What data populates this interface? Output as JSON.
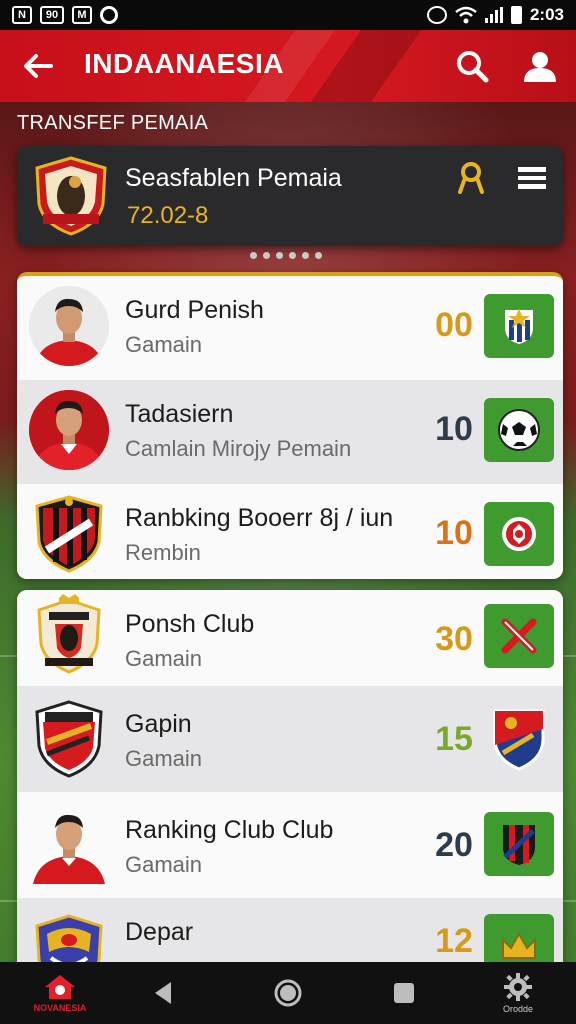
{
  "status_bar": {
    "left_icons": [
      "sim-icon",
      "nfc-icon",
      "calendar-icon",
      "sync-icon"
    ],
    "right_icons": [
      "vibrate-icon",
      "wifi-icon",
      "signal-icon",
      "battery-icon"
    ],
    "time": "2:03",
    "left_glyphs": [
      "N",
      "90",
      "M"
    ]
  },
  "app_bar": {
    "title": "INDAANAESIA",
    "accent": "#d0141c"
  },
  "section": {
    "label": "TRANSFEF PEMAIA"
  },
  "featured": {
    "title": "Seasfablen Pemaia",
    "date": "72.02-8",
    "carousel_pages": 6
  },
  "list_a": [
    {
      "name": "Gurd Penish",
      "subtitle": "Gamain",
      "score": "00",
      "score_color": "#d69a1a",
      "badge": "shield-star-icon",
      "avatar": "player-photo"
    },
    {
      "name": "Tadasiern",
      "subtitle": "Camlain Mirojy Pemain",
      "score": "10",
      "score_color": "#2d3b4a",
      "badge": "soccer-ball-icon",
      "avatar": "player-photo"
    },
    {
      "name": "Ranbking Booerr 8j / iun",
      "subtitle": "Rembin",
      "score": "10",
      "score_color": "#d9731a",
      "badge": "ball-badge-icon",
      "avatar": "club-crest"
    }
  ],
  "list_b": [
    {
      "name": "Ponsh Club",
      "subtitle": "Gamain",
      "score": "30",
      "score_color": "#d69a1a",
      "badge": "crossed-swords-icon",
      "avatar": "club-crest"
    },
    {
      "name": "Gapin",
      "subtitle": "Gamain",
      "score": "15",
      "score_color": "#7aa82a",
      "badge": "club-shield-icon",
      "avatar": "club-crest"
    },
    {
      "name": "Ranking Club Club",
      "subtitle": "Gamain",
      "score": "20",
      "score_color": "#2d3b4a",
      "badge": "striped-shield-icon",
      "avatar": "player-photo"
    },
    {
      "name": "Depar",
      "subtitle": "",
      "score": "12",
      "score_color": "#d69a1a",
      "badge": "crown-icon",
      "avatar": "club-crest"
    }
  ],
  "bottom_nav": {
    "home_label": "NOVANESIA",
    "settings_label": "Orodde"
  }
}
